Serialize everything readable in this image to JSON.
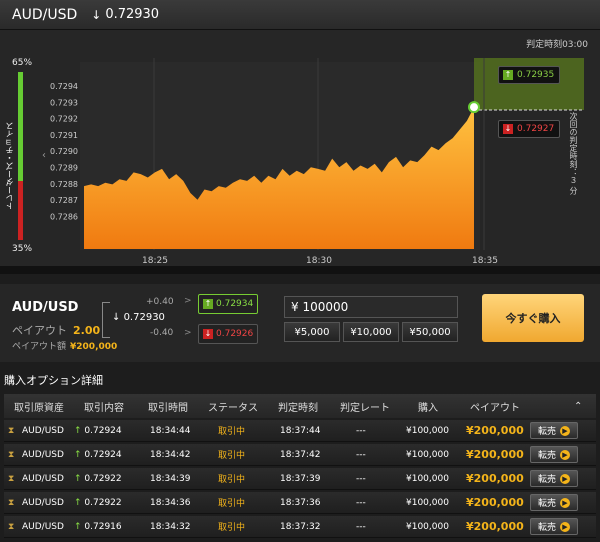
{
  "header": {
    "pair": "AUD/USD",
    "rate_arrow": "down-arrow",
    "rate": "0.72930"
  },
  "chart": {
    "deadline_label": "判定時刻03:00",
    "gauge_top": "65%",
    "gauge_bottom": "35%",
    "gauge_high_fraction": 0.65,
    "gauge_label": "トレーダーズ・チョイス",
    "next_deadline_note": "次回の判定時刻：３ 分",
    "up_price": "0.72935",
    "down_price": "0.72927",
    "colors": {
      "area": "#f4a020",
      "accent_green": "#7c3",
      "red": "#c22"
    }
  },
  "chart_data": {
    "type": "area",
    "title": "",
    "xlabel": "",
    "ylabel": "",
    "y_ticks": [
      "0.7294",
      "0.7293",
      "0.7292",
      "0.7291",
      "0.7290",
      "0.7289",
      "0.7288",
      "0.7287",
      "0.7286"
    ],
    "x_ticks": [
      "18:25",
      "18:30",
      "18:35"
    ],
    "ylim": [
      0.7285,
      0.72945
    ],
    "series": [
      {
        "values": [
          0.72882,
          0.72883,
          0.72882,
          0.72884,
          0.72883,
          0.72886,
          0.72885,
          0.7289,
          0.72889,
          0.72887,
          0.7289,
          0.72892,
          0.72886,
          0.72889,
          0.72885,
          0.72878,
          0.72874,
          0.7288,
          0.72879,
          0.72882,
          0.72881,
          0.72884,
          0.72886,
          0.72885,
          0.72888,
          0.72884,
          0.72888,
          0.72886,
          0.72892,
          0.72888,
          0.72891,
          0.72889,
          0.72893,
          0.72892,
          0.72891,
          0.72898,
          0.72893,
          0.72896,
          0.72891,
          0.72894,
          0.72892,
          0.72895,
          0.7289,
          0.72896,
          0.72899,
          0.72893,
          0.72897,
          0.72896,
          0.729,
          0.72905,
          0.72903,
          0.72907,
          0.7291,
          0.72915,
          0.7292,
          0.72928
        ]
      }
    ]
  },
  "panel": {
    "pair": "AUD/USD",
    "payout_label": "ペイアウト",
    "payout_value": "2.00",
    "payout_amount_label": "ペイアウト額",
    "payout_amount": "¥200,000",
    "strike": "0.72930",
    "plus": "+0.40",
    "minus": "-0.40",
    "high_price": "0.72934",
    "low_price": "0.72926",
    "amount": "¥ 100000",
    "quick": [
      "¥5,000",
      "¥10,000",
      "¥50,000"
    ],
    "buy_label": "今すぐ購入"
  },
  "options": {
    "title": "購入オプション詳細",
    "headers": [
      "取引原資産",
      "取引内容",
      "取引時間",
      "ステータス",
      "判定時刻",
      "判定レート",
      "購入",
      "ペイアウト"
    ],
    "sell_label": "転売",
    "rows": [
      {
        "asset": "AUD/USD",
        "content": "0.72924",
        "time": "18:34:44",
        "status": "取引中",
        "deadline": "18:37:44",
        "rate": "---",
        "buy": "¥100,000",
        "payout": "¥200,000"
      },
      {
        "asset": "AUD/USD",
        "content": "0.72924",
        "time": "18:34:42",
        "status": "取引中",
        "deadline": "18:37:42",
        "rate": "---",
        "buy": "¥100,000",
        "payout": "¥200,000"
      },
      {
        "asset": "AUD/USD",
        "content": "0.72922",
        "time": "18:34:39",
        "status": "取引中",
        "deadline": "18:37:39",
        "rate": "---",
        "buy": "¥100,000",
        "payout": "¥200,000"
      },
      {
        "asset": "AUD/USD",
        "content": "0.72922",
        "time": "18:34:36",
        "status": "取引中",
        "deadline": "18:37:36",
        "rate": "---",
        "buy": "¥100,000",
        "payout": "¥200,000"
      },
      {
        "asset": "AUD/USD",
        "content": "0.72916",
        "time": "18:34:32",
        "status": "取引中",
        "deadline": "18:37:32",
        "rate": "---",
        "buy": "¥100,000",
        "payout": "¥200,000"
      }
    ]
  }
}
